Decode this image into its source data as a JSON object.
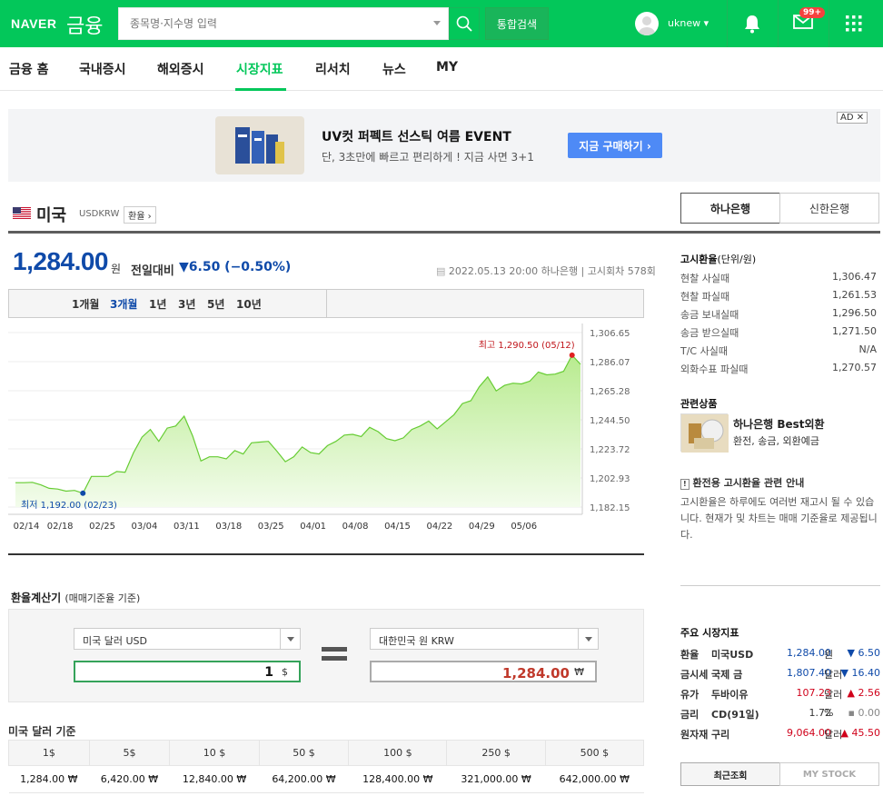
{
  "header": {
    "logo": "NAVER",
    "service": "금융",
    "search_placeholder": "종목명·지수명 입력",
    "total_search": "통합검색",
    "username": "uknew ▾",
    "mail_badge": "99+"
  },
  "nav": {
    "items": [
      "금융 홈",
      "국내증시",
      "해외증시",
      "시장지표",
      "리서치",
      "뉴스",
      "MY"
    ],
    "active": "시장지표"
  },
  "ad": {
    "title": "UV컷 퍼펙트 선스틱 여름 EVENT",
    "subtitle": "단, 3초만에 빠르고 편리하게 ! 지금 사면 3+1",
    "button": "지금 구매하기 ›",
    "badge": "AD ✕"
  },
  "currency": {
    "country": "미국",
    "code": "USDKRW",
    "tag": "환율",
    "price": "1,284.00",
    "unit": "원",
    "change_label": "전일대비",
    "change": "▼6.50 (−0.50%)",
    "meta": "2022.05.13 20:00  하나은행  |  고시회차 578회"
  },
  "bank_tabs": [
    "하나은행",
    "신한은행"
  ],
  "periods": [
    "1개월",
    "3개월",
    "1년",
    "3년",
    "5년",
    "10년"
  ],
  "active_period": "3개월",
  "chart_data": {
    "type": "area",
    "x_ticks": [
      "02/14",
      "02/18",
      "02/25",
      "03/04",
      "03/11",
      "03/18",
      "03/25",
      "04/01",
      "04/08",
      "04/15",
      "04/22",
      "04/29",
      "05/06"
    ],
    "y_ticks": [
      "1,306.65",
      "1,286.07",
      "1,265.28",
      "1,244.50",
      "1,223.72",
      "1,202.93",
      "1,182.15"
    ],
    "ylim": [
      1182.15,
      1306.65
    ],
    "values": [
      1199.5,
      1199.5,
      1199.8,
      1198.0,
      1195.5,
      1195.0,
      1193.5,
      1194.0,
      1192.0,
      1204.0,
      1204.0,
      1204.0,
      1207.5,
      1207.0,
      1221.0,
      1232.0,
      1237.5,
      1229.0,
      1238.5,
      1240.0,
      1247.0,
      1233.0,
      1215.0,
      1218.0,
      1218.0,
      1216.5,
      1222.5,
      1220.0,
      1228.0,
      1228.5,
      1229.0,
      1222.0,
      1214.5,
      1218.0,
      1225.0,
      1221.0,
      1220.0,
      1226.0,
      1229.0,
      1233.5,
      1234.0,
      1232.5,
      1239.0,
      1236.0,
      1231.0,
      1229.5,
      1231.5,
      1237.5,
      1240.0,
      1243.5,
      1238.0,
      1243.0,
      1248.0,
      1256.0,
      1258.0,
      1268.0,
      1275.0,
      1265.0,
      1269.0,
      1270.5,
      1270.0,
      1272.0,
      1278.5,
      1276.5,
      1277.0,
      1279.0,
      1290.5,
      1284.0
    ],
    "max_label": "최고 1,290.50 (05/12)",
    "min_label": "최저 1,192.00 (02/23)",
    "line_color": "#66cc33"
  },
  "calc": {
    "title": "환율계산기",
    "title_sub": "(매매기준율 기준)",
    "from_currency": "미국 달러 USD",
    "to_currency": "대한민국 원 KRW",
    "from_value": "1",
    "from_unit": "$",
    "to_value": "1,284.00",
    "to_unit": "₩"
  },
  "amount_table": {
    "title": "미국 달러 기준",
    "headers": [
      "1$",
      "5$",
      "10 $",
      "50 $",
      "100 $",
      "250 $",
      "500 $"
    ],
    "values": [
      "1,284.00 ₩",
      "6,420.00 ₩",
      "12,840.00 ₩",
      "64,200.00 ₩",
      "128,400.00 ₩",
      "321,000.00 ₩",
      "642,000.00 ₩"
    ]
  },
  "rates": {
    "title": "고시환율",
    "title_sub": "(단위/원)",
    "rows": [
      {
        "label": "현찰 사실때",
        "value": "1,306.47"
      },
      {
        "label": "현찰 파실때",
        "value": "1,261.53"
      },
      {
        "label": "송금 보내실때",
        "value": "1,296.50"
      },
      {
        "label": "송금 받으실때",
        "value": "1,271.50"
      },
      {
        "label": "T/C 사실때",
        "value": "N/A"
      },
      {
        "label": "외화수표 파실때",
        "value": "1,270.57"
      }
    ]
  },
  "related": {
    "title": "관련상품",
    "name": "하나은행 Best외환",
    "desc": "환전, 송금, 외환예금"
  },
  "notice": {
    "title": "환전용 고시환율 관련 안내",
    "body": "고시환율은 하루에도 여러번 재고시 될 수 있습니다. 현재가 및 차트는 매매 기준율로 제공됩니다."
  },
  "market": {
    "title": "주요 시장지표",
    "rows": [
      {
        "cat": "환율",
        "name": "미국USD",
        "value": "1,284.00",
        "unit": "원",
        "change": "▼ 6.50",
        "dir": "down"
      },
      {
        "cat": "금시세",
        "name": "국제 금",
        "value": "1,807.40",
        "unit": "달러",
        "change": "▼ 16.40",
        "dir": "down"
      },
      {
        "cat": "유가",
        "name": "두바이유",
        "value": "107.23",
        "unit": "달러",
        "change": "▲ 2.56",
        "dir": "up"
      },
      {
        "cat": "금리",
        "name": "CD(91일)",
        "value": "1.72",
        "unit": "%",
        "change": "▪ 0.00",
        "dir": "flat"
      },
      {
        "cat": "원자재",
        "name": "구리",
        "value": "9,064.00",
        "unit": "달러",
        "change": "▲ 45.50",
        "dir": "up"
      }
    ]
  },
  "bottom_tabs": [
    "최근조회",
    "MY STOCK"
  ]
}
